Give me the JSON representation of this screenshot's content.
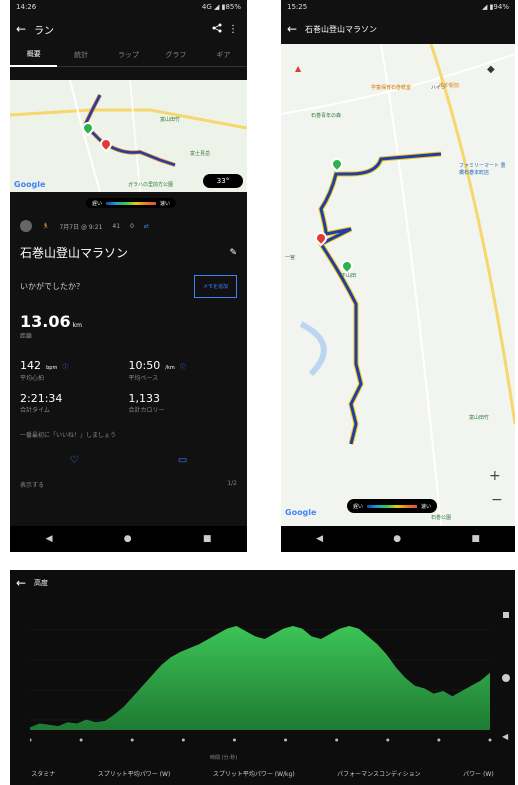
{
  "phone1": {
    "status": {
      "time": "14:26",
      "right": "4G ◢ ▮85%"
    },
    "appbar": {
      "back": "←",
      "title": "ラン"
    },
    "tabs": [
      "概要",
      "統計",
      "ラップ",
      "グラフ",
      "ギア"
    ],
    "map": {
      "poi1": "富山田竹",
      "poi2": "富士見岳",
      "poi3": "ガラハの里前方公園",
      "google": "Google",
      "temp": "33°"
    },
    "legend": {
      "slow": "遅い",
      "fast": "速い"
    },
    "activity": {
      "date": "7月7日 @ 9:21",
      "likes": "41",
      "comments": "0",
      "title": "石巻山登山マラソン",
      "prompt": "いかがでしたか？",
      "memo_button": "メモを追加",
      "distance": "13.06",
      "distance_unit": "km",
      "distance_label": "距離",
      "hr": "142",
      "hr_unit": "bpm",
      "hr_label": "平均心拍",
      "pace": "10:50",
      "pace_unit": "/km",
      "pace_label": "平均ペース",
      "time": "2:21:34",
      "time_label": "合計タイム",
      "cal": "1,133",
      "cal_label": "合計カロリー",
      "cheer": "一番最初に「いいね！」しましょう",
      "footer_left": "表示する",
      "footer_right": "1/2"
    },
    "nav": {
      "back": "◀",
      "home": "●",
      "recent": "■"
    }
  },
  "phone2": {
    "status": {
      "time": "15:25",
      "right": "◢ ▮94%"
    },
    "appbar": {
      "back": "←",
      "title": "石巻山登山マラソン"
    },
    "map": {
      "poi1": "市や駅前",
      "poi2": "学童保育石巻教室",
      "poi3": "石巻青年の森",
      "poi4": "ファミリーマート 豊橋石巻本町店",
      "poi5": "一宮",
      "poi6": "下山田",
      "poi7": "富山田竹",
      "poi8": "石巻公園",
      "poi9": "ハイツ",
      "google": "Google",
      "zoom_in": "+",
      "zoom_out": "−"
    },
    "legend": {
      "slow": "遅い",
      "fast": "速い"
    },
    "nav": {
      "back": "◀",
      "home": "●",
      "recent": "■"
    }
  },
  "phone3": {
    "appbar": {
      "back": "←",
      "title": "高度"
    },
    "xlabel": "時間 (分:秒)",
    "metrics": [
      "スタミナ",
      "スプリット平均パワー (W)",
      "スプリット平均パワー (W/kg)",
      "パフォーマンスコンディション",
      "パワー (W)"
    ]
  },
  "chart_data": {
    "type": "area",
    "title": "高度",
    "xlabel": "時間 (分:秒)",
    "ylabel": "",
    "values": [
      2,
      5,
      4,
      3,
      6,
      5,
      8,
      6,
      7,
      12,
      18,
      26,
      34,
      42,
      50,
      56,
      60,
      63,
      66,
      70,
      74,
      78,
      80,
      76,
      72,
      70,
      74,
      78,
      80,
      78,
      72,
      70,
      74,
      78,
      80,
      78,
      72,
      66,
      58,
      48,
      40,
      34,
      32,
      28,
      30,
      26,
      30,
      34,
      38,
      44
    ],
    "color": "#2fb24c"
  }
}
